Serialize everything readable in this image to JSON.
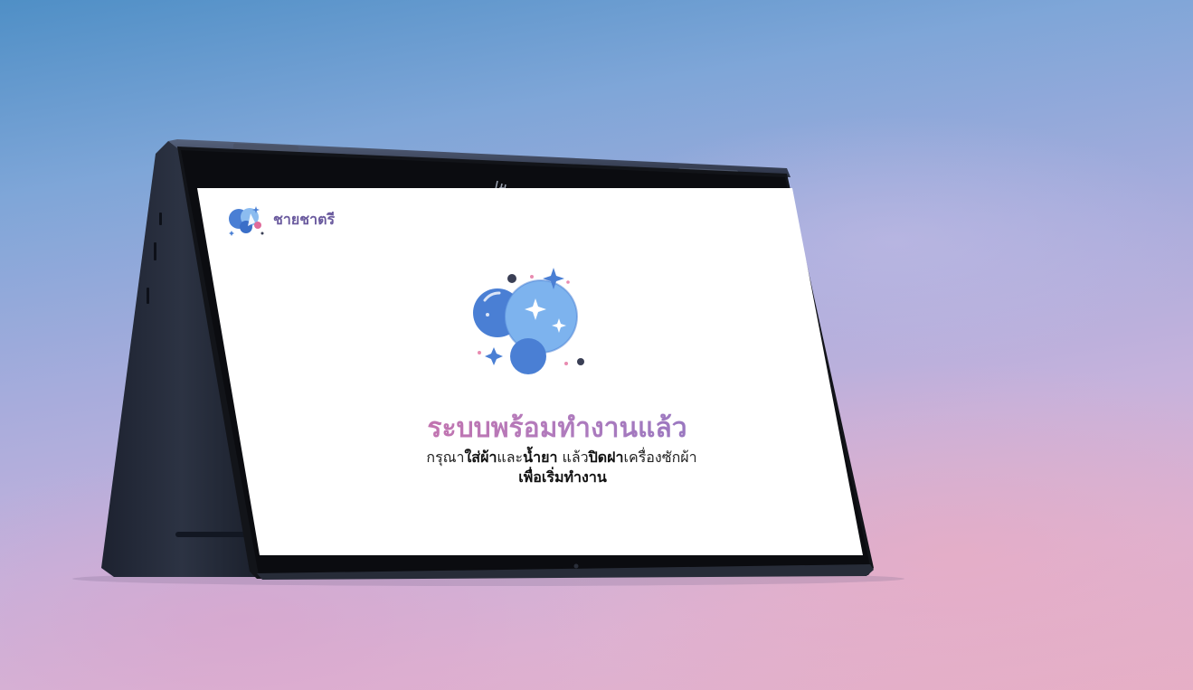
{
  "device": {
    "logo_mark": "hp-logo",
    "bezel_color": "#111418",
    "body_color": "#2d3444"
  },
  "app": {
    "brand_name": "ชายชาตรี",
    "brand_icon": "bubbles-logo-icon"
  },
  "status": {
    "illustration": "bubbles-sparkle-icon",
    "title": "ระบบพร้อมทำงานแล้ว",
    "instruction": {
      "prefix": "กรุณา",
      "bold1": "ใส่ผ้า",
      "mid1": "และ",
      "bold2": "น้ำยา",
      "mid2": " แล้ว",
      "bold3": "ปิดฝา",
      "suffix": "เครื่องซักผ้า"
    },
    "instruction_line2": "เพื่อเริ่มทำงาน"
  },
  "colors": {
    "title_gradient_start": "#e0699a",
    "title_gradient_end": "#7b73c4",
    "bubble_dark": "#4a7fd4",
    "bubble_light": "#7db3ee",
    "brand_text": "#6a5a9e"
  }
}
